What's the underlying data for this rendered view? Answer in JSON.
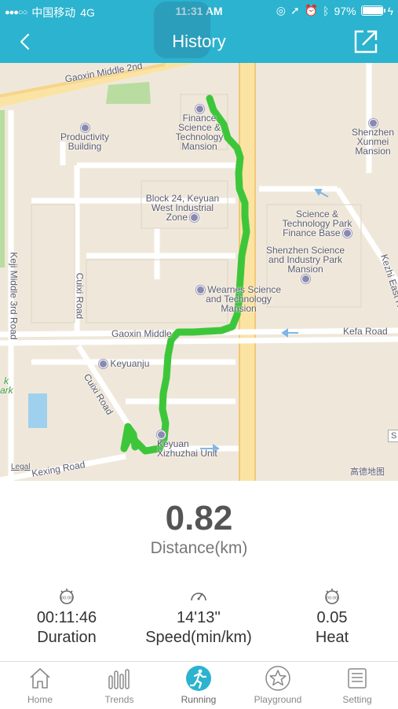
{
  "status_bar": {
    "carrier": "中国移动",
    "network": "4G",
    "time": "11:31 AM",
    "battery": "97%",
    "battery_level": 0.97
  },
  "header": {
    "title": "History"
  },
  "map": {
    "labels": {
      "gaoxin_middle_top": "Gaoxin Middle 2nd",
      "productivity": "Productivity Building",
      "finance": "Finance Science & Technology Mansion",
      "xunmei": "Shenzhen Xunmei Mansion",
      "block24": "Block 24, Keyuan West Industrial Zone",
      "stpark": "Science & Technology Park Finance Base",
      "szsci": "Shenzhen Science and Industry Park Mansion",
      "wearnes": "Wearnes Science and Technology Mansion",
      "keji": "Keji Middle 3rd Road",
      "cuixi": "Cuixi Road",
      "gaoxin_middle": "Gaoxin Middle",
      "kefa": "Kefa Road",
      "keyuanju": "Keyuanju",
      "cuixi2": "Cuixi Road",
      "keyuan_xizhuzhai": "Keyuan Xizhuzhai Unit",
      "kexing": "Kexing Road",
      "kezhi": "Kezhi East Road",
      "park": "k ark",
      "legal": "Legal",
      "gaode": "高德地图",
      "s_badge": "S"
    }
  },
  "stats": {
    "distance_value": "0.82",
    "distance_label": "Distance(km)",
    "duration_value": "00:11:46",
    "duration_label": "Duration",
    "speed_value": "14'13''",
    "speed_label": "Speed(min/km)",
    "heat_value": "0.05",
    "heat_label": "Heat",
    "icons": [
      "stopwatch-icon",
      "speedometer-icon",
      "stopwatch-icon"
    ]
  },
  "tabbar": {
    "items": [
      {
        "label": "Home",
        "icon": "home-icon"
      },
      {
        "label": "Trends",
        "icon": "trends-icon"
      },
      {
        "label": "Running",
        "icon": "running-icon",
        "active": true
      },
      {
        "label": "Playground",
        "icon": "star-icon"
      },
      {
        "label": "Setting",
        "icon": "list-icon"
      }
    ]
  },
  "colors": {
    "header_bg": "#2bb3cf",
    "route": "#3ec63b",
    "active_tab": "#2bb3cf",
    "map_bg": "#efe8da"
  }
}
